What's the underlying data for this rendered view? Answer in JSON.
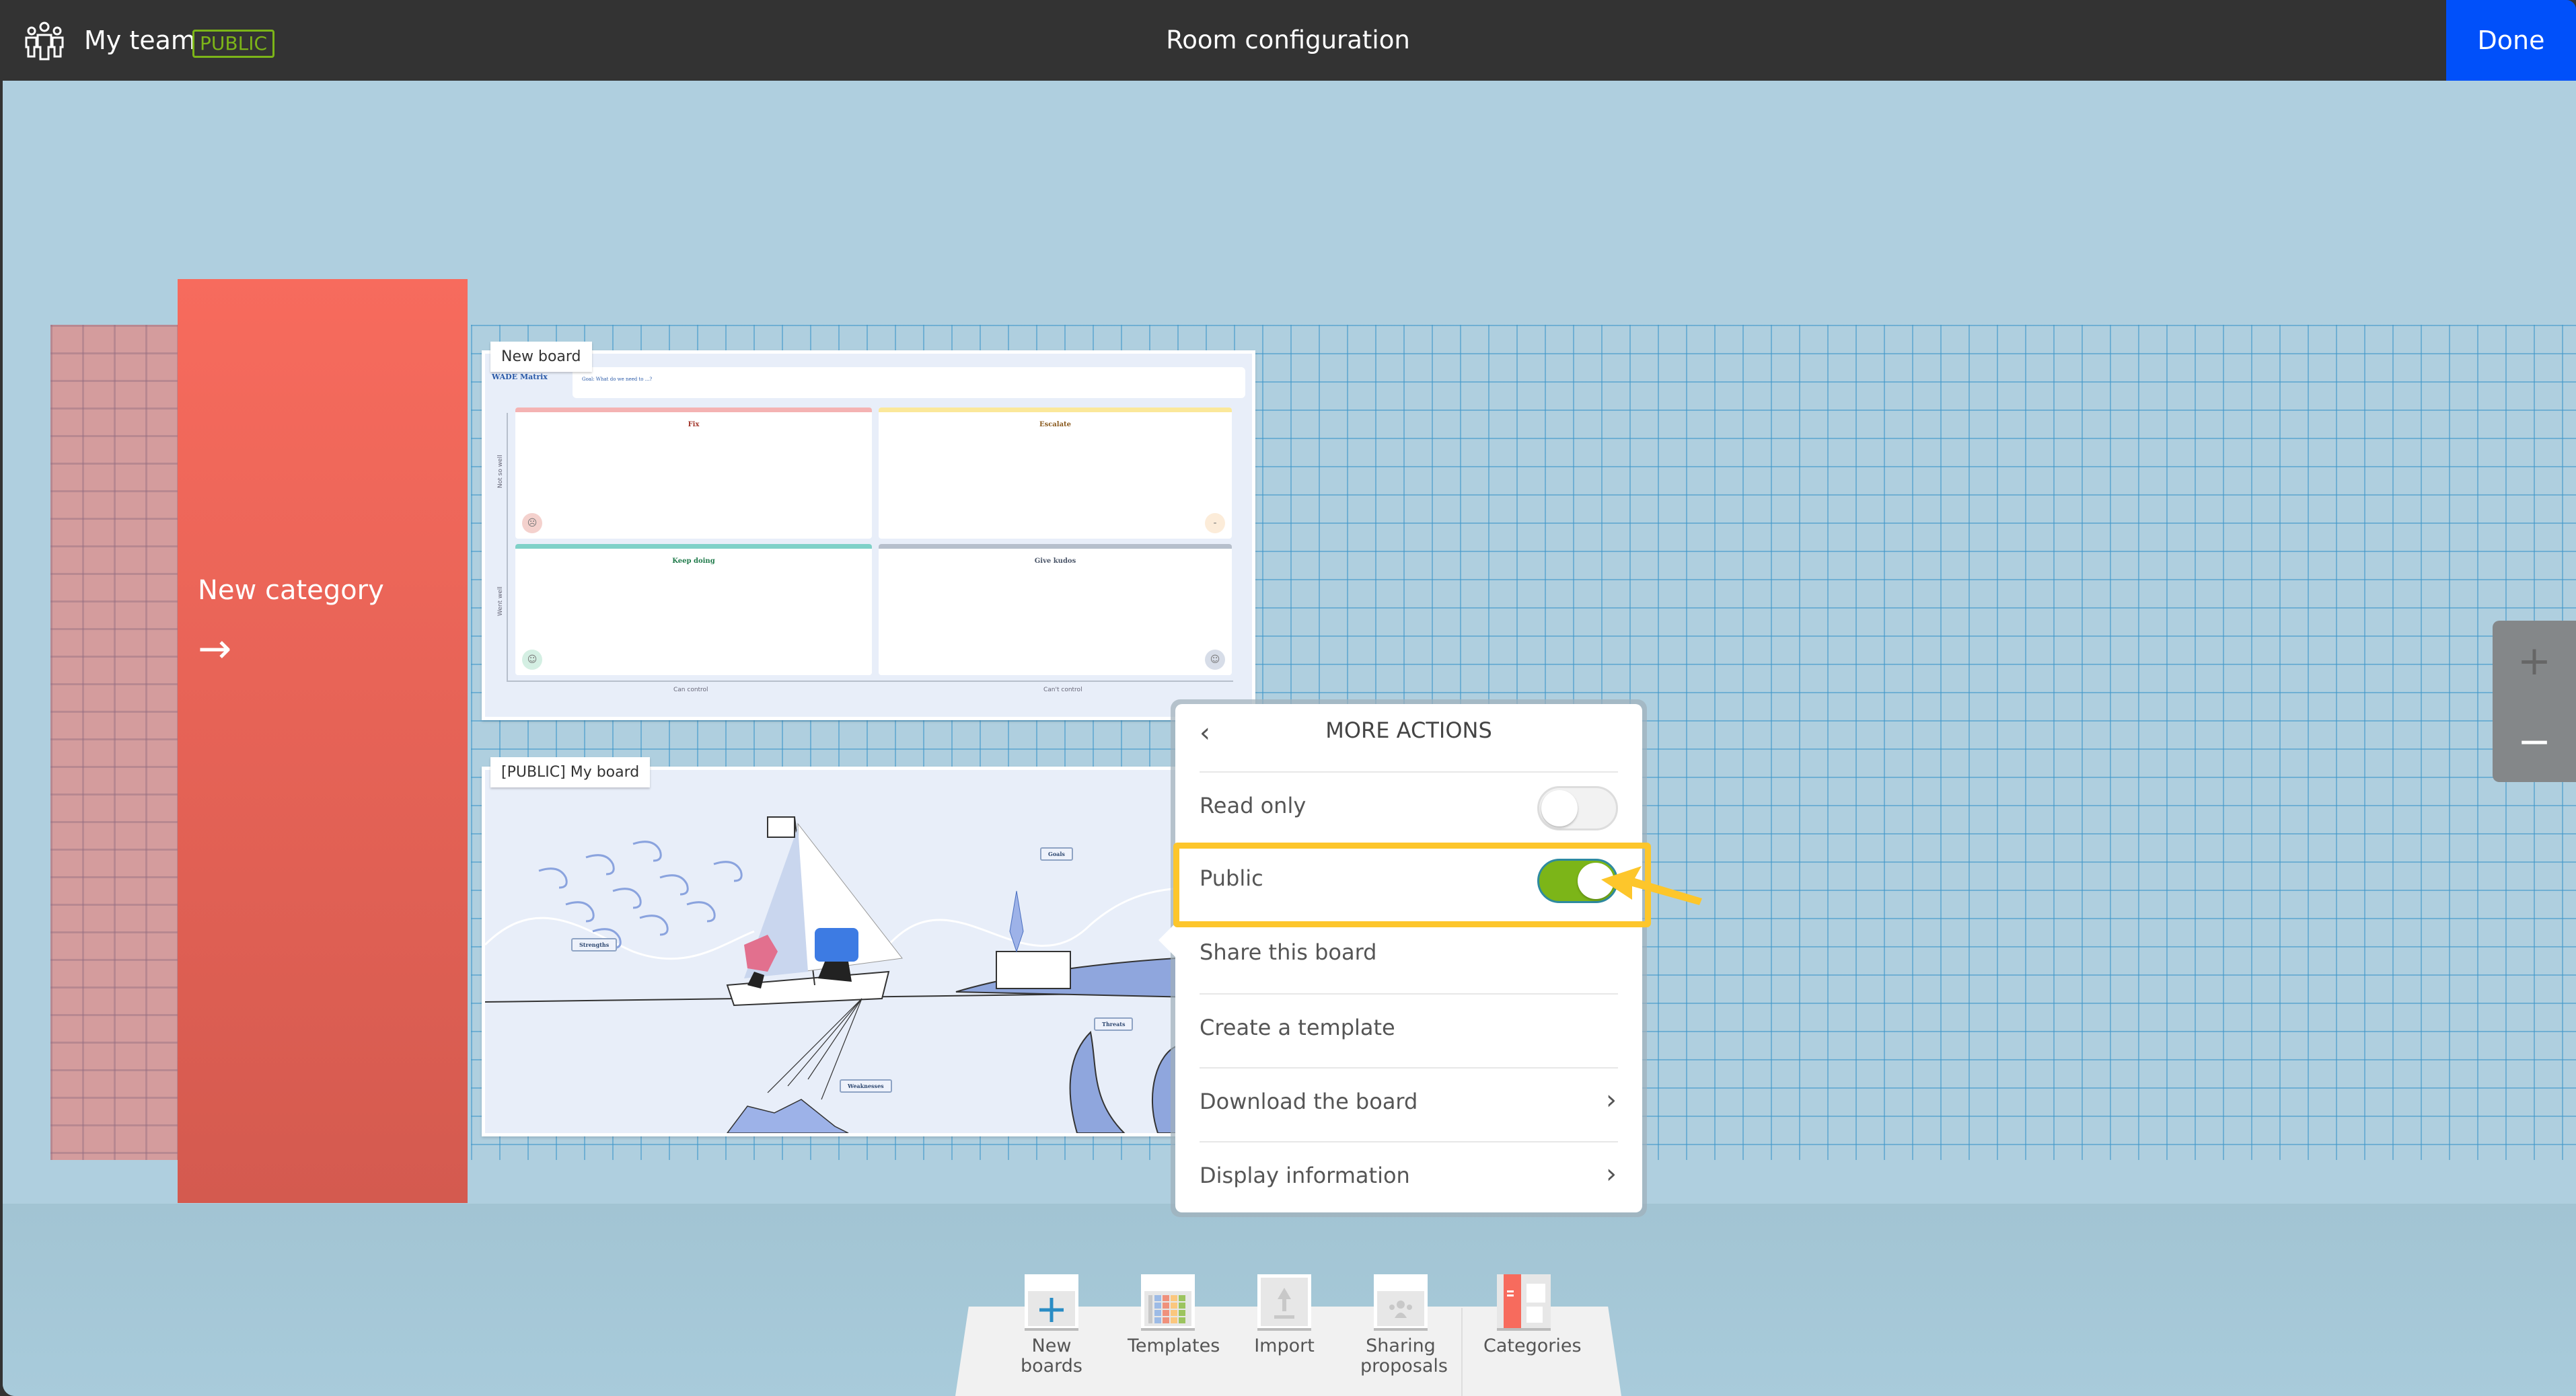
{
  "header": {
    "team_icon": "team-icon",
    "team_name": "My team",
    "team_badge": "PUBLIC",
    "title": "Room configuration",
    "done_label": "Done"
  },
  "colors": {
    "topbar": "#333333",
    "done": "#0050fa",
    "public_badge": "#7cb518",
    "canvas": "#afcfdf",
    "category": "#f06a5b",
    "highlight": "#fdc62b",
    "toggle_on": "#7cb518"
  },
  "category": {
    "label": "New category",
    "arrow": "→"
  },
  "boards": [
    {
      "name": "New board",
      "template": {
        "title": "WADE Matrix",
        "goal": "Goal: What do we need to ...?",
        "quadrants": [
          {
            "label": "Fix",
            "color": "#f4b3b3",
            "text_color": "#a2352a",
            "face": "☹"
          },
          {
            "label": "Escalate",
            "color": "#fbe89a",
            "text_color": "#8a5a1e",
            "face": "‐"
          },
          {
            "label": "Keep doing",
            "color": "#7fd1c8",
            "text_color": "#1f7a4a",
            "face": "☺"
          },
          {
            "label": "Give kudos",
            "color": "#b6bfcc",
            "text_color": "#4a5568",
            "face": "☺"
          }
        ],
        "y_axis": [
          "Not so well",
          "Went well"
        ],
        "x_axis": [
          "Can control",
          "Can't control"
        ]
      }
    },
    {
      "name": "[PUBLIC] My board",
      "template": {
        "labels": [
          "Strengths",
          "Goals",
          "Threats",
          "Weaknesses"
        ]
      }
    }
  ],
  "popover": {
    "title": "MORE ACTIONS",
    "back_icon": "‹",
    "items": [
      {
        "label": "Read only",
        "type": "toggle",
        "value": false
      },
      {
        "label": "Public",
        "type": "toggle",
        "value": true,
        "highlighted": true
      },
      {
        "label": "Share this board",
        "type": "action"
      },
      {
        "label": "Create a template",
        "type": "action"
      },
      {
        "label": "Download the board",
        "type": "submenu",
        "chevron": "›"
      },
      {
        "label": "Display information",
        "type": "submenu",
        "chevron": "›"
      }
    ]
  },
  "zoom_controls": {
    "zoom_in": "+",
    "zoom_out": "−"
  },
  "dock": {
    "items": [
      {
        "label": "New boards",
        "icon": "plus-icon"
      },
      {
        "label": "Templates",
        "icon": "templates-icon"
      },
      {
        "label": "Import",
        "icon": "upload-icon"
      },
      {
        "label": "Sharing proposals",
        "icon": "sharing-icon"
      },
      {
        "label": "Categories",
        "icon": "categories-icon"
      }
    ]
  }
}
